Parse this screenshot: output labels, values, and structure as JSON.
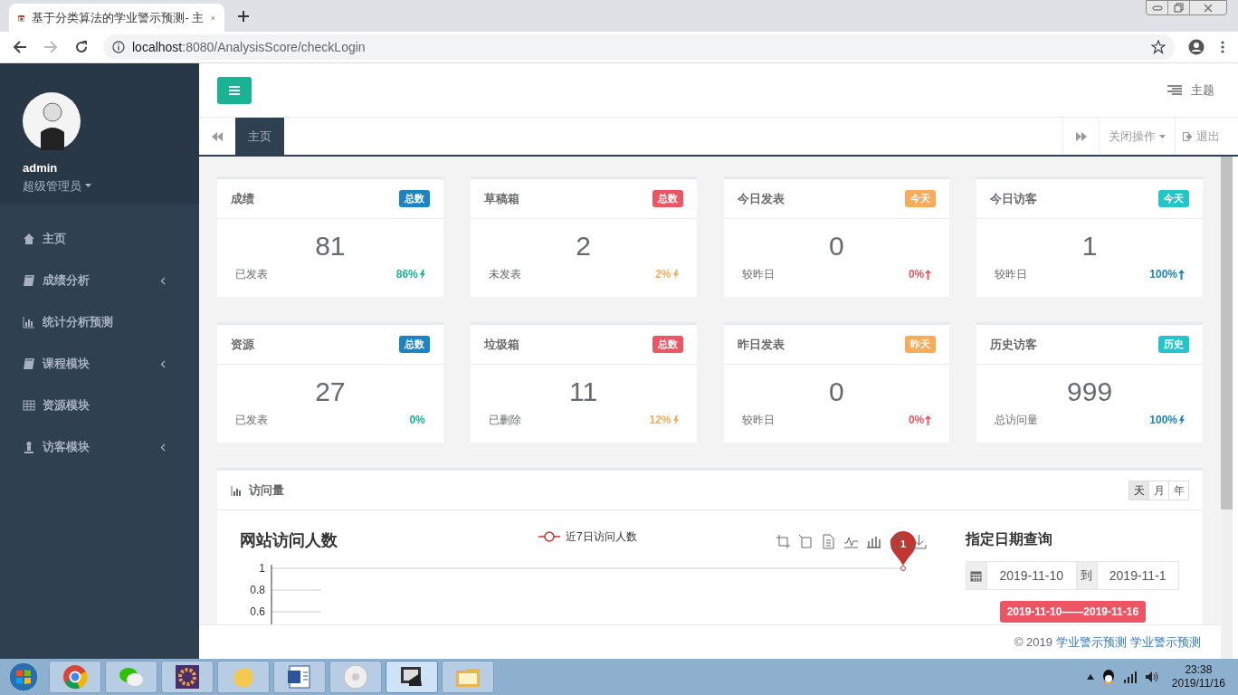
{
  "browser": {
    "tab_title": "基于分类算法的学业警示预测- 主",
    "url_host": "localhost",
    "url_rest": ":8080/AnalysisScore/checkLogin"
  },
  "sidebar": {
    "user": "admin",
    "role": "超级管理员",
    "items": [
      {
        "kind": "home",
        "label": "主页",
        "has_children": false
      },
      {
        "kind": "book",
        "label": "成绩分析",
        "has_children": true
      },
      {
        "kind": "chart",
        "label": "统计分析预测",
        "has_children": false
      },
      {
        "kind": "book",
        "label": "课程模块",
        "has_children": true
      },
      {
        "kind": "grid",
        "label": "资源模块",
        "has_children": false
      },
      {
        "kind": "user",
        "label": "访客模块",
        "has_children": true
      }
    ]
  },
  "header": {
    "theme": "主题"
  },
  "page_tabs": {
    "tabs": [
      {
        "label": "主页",
        "selected": true
      }
    ],
    "close_ops": "关闭操作",
    "logout": "退出"
  },
  "cards": [
    {
      "title": "成绩",
      "badge": "总数",
      "color": "#1c84c6",
      "value": "81",
      "note": "已发表",
      "change": {
        "text": "86%",
        "color": "#1ab394",
        "kind": "bolt"
      }
    },
    {
      "title": "草稿箱",
      "badge": "总数",
      "color": "#ed5565",
      "value": "2",
      "note": "未发表",
      "change": {
        "text": "2%",
        "color": "#f8ac59",
        "kind": "bolt"
      }
    },
    {
      "title": "今日发表",
      "badge": "今天",
      "color": "#f8ac59",
      "value": "0",
      "note": "较昨日",
      "change": {
        "text": "0%",
        "color": "#ed5565",
        "kind": "up"
      }
    },
    {
      "title": "今日访客",
      "badge": "今天",
      "color": "#23c6c8",
      "value": "1",
      "note": "较昨日",
      "change": {
        "text": "100%",
        "color": "#1c84c6",
        "kind": "up"
      }
    },
    {
      "title": "资源",
      "badge": "总数",
      "color": "#1c84c6",
      "value": "27",
      "note": "已发表",
      "change": {
        "text": "0%",
        "color": "#1ab394",
        "kind": "plain"
      }
    },
    {
      "title": "垃圾箱",
      "badge": "总数",
      "color": "#ed5565",
      "value": "11",
      "note": "已删除",
      "change": {
        "text": "12%",
        "color": "#f8ac59",
        "kind": "bolt"
      }
    },
    {
      "title": "昨日发表",
      "badge": "昨天",
      "color": "#f8ac59",
      "value": "0",
      "note": "较昨日",
      "change": {
        "text": "0%",
        "color": "#ed5565",
        "kind": "up"
      }
    },
    {
      "title": "历史访客",
      "badge": "历史",
      "color": "#23c6c8",
      "value": "999",
      "note": "总访问量",
      "change": {
        "text": "100%",
        "color": "#1c84c6",
        "kind": "bolt"
      }
    }
  ],
  "visits": {
    "title": "访问量",
    "ranges": [
      {
        "label": "天",
        "selected": true
      },
      {
        "label": "月",
        "selected": false
      },
      {
        "label": "年",
        "selected": false
      }
    ],
    "chart": {
      "title": "网站访问人数",
      "legend": "近7日访问人数",
      "y_axis_labels": [
        "1",
        "0.8",
        "0.6"
      ],
      "marker_label": "1"
    },
    "query": {
      "title": "指定日期查询",
      "from": "2019-11-10",
      "to_label": "到",
      "to": "2019-11-1",
      "range_tag": "2019-11-10——2019-11-16"
    }
  },
  "footer": {
    "copyright": "© 2019",
    "links": [
      "学业警示预测",
      "学业警示预测"
    ]
  },
  "taskbar": {
    "time": "23:38",
    "date": "2019/11/16"
  }
}
